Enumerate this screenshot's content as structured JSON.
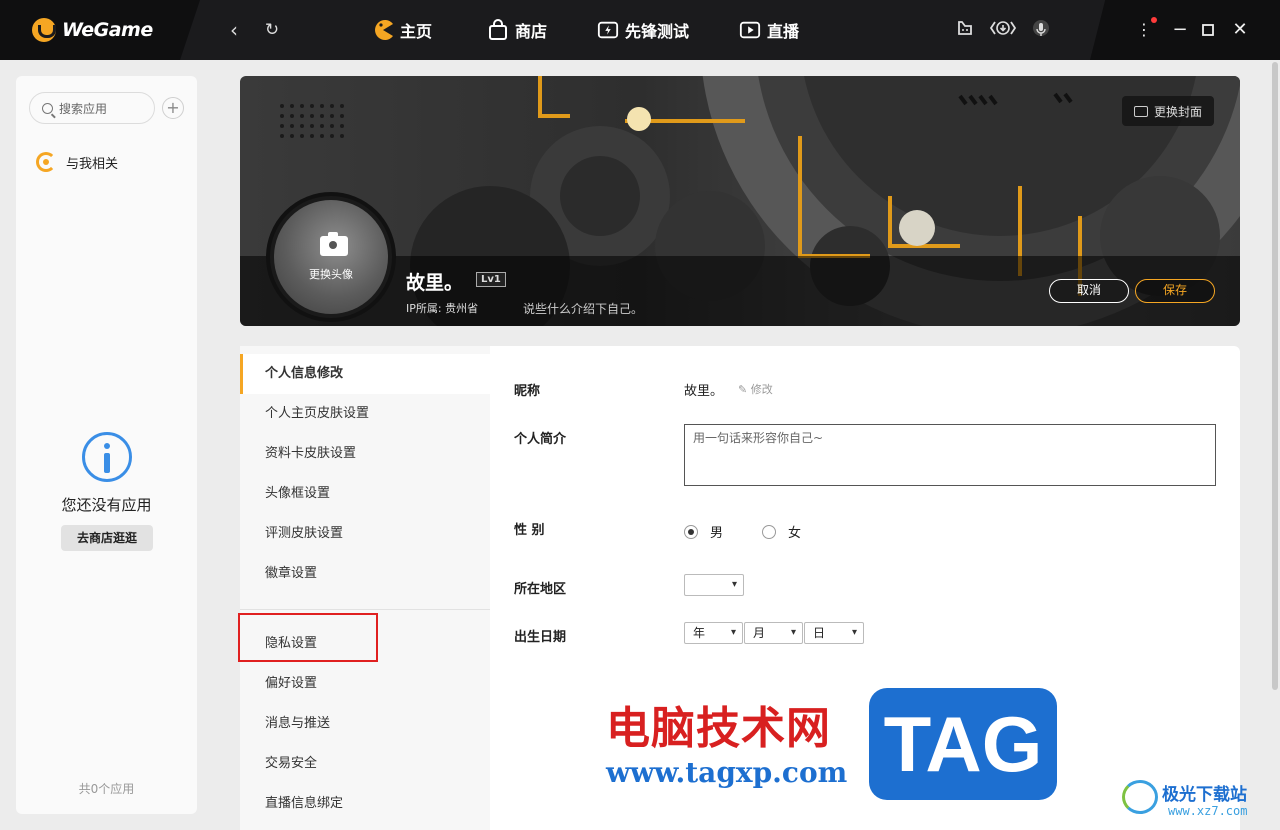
{
  "app": {
    "logo_text": "WeGame"
  },
  "topbar": {
    "back_icon": "chevron-left-icon",
    "refresh_icon": "refresh-icon",
    "tabs": [
      {
        "label": "主页",
        "icon": "pacman-icon"
      },
      {
        "label": "商店",
        "icon": "bag-icon"
      },
      {
        "label": "先锋测试",
        "icon": "flash-icon"
      },
      {
        "label": "直播",
        "icon": "play-icon"
      }
    ],
    "tools": [
      "chat-bot-icon",
      "download-icon",
      "voice-icon"
    ],
    "window": [
      "more-icon",
      "minimize-icon",
      "maximize-icon",
      "close-icon"
    ],
    "accent": "#f5a623"
  },
  "sidebar": {
    "search_placeholder": "搜索应用",
    "add_label": "+",
    "related_label": "与我相关",
    "empty_text": "您还没有应用",
    "store_button": "去商店逛逛",
    "app_count": "共0个应用"
  },
  "profile": {
    "change_cover": "更换封面",
    "change_avatar": "更换头像",
    "nickname": "故里。",
    "level": "Lv1",
    "ip_location": "IP所属: 贵州省",
    "intro_placeholder": "说些什么介绍下自己。",
    "cancel": "取消",
    "save": "保存"
  },
  "menu": {
    "items": [
      "个人信息修改",
      "个人主页皮肤设置",
      "资料卡皮肤设置",
      "头像框设置",
      "评测皮肤设置",
      "徽章设置",
      "隐私设置",
      "偏好设置",
      "消息与推送",
      "交易安全",
      "直播信息绑定"
    ],
    "active_index": 0,
    "highlighted": "隐私设置"
  },
  "form": {
    "nickname_label": "昵称",
    "nickname_value": "故里。",
    "edit_label": "修改",
    "bio_label": "个人简介",
    "bio_placeholder": "用一句话来形容你自己~",
    "gender_label": "性 别",
    "gender_male": "男",
    "gender_female": "女",
    "gender_selected": "男",
    "region_label": "所在地区",
    "region_value": "",
    "birthday_label": "出生日期",
    "year": "年",
    "month": "月",
    "day": "日"
  },
  "watermark": {
    "cn": "电脑技术网",
    "url": "www.tagxp.com",
    "tag": "TAG",
    "site2": "极光下载站",
    "site2_url": "www.xz7.com"
  }
}
